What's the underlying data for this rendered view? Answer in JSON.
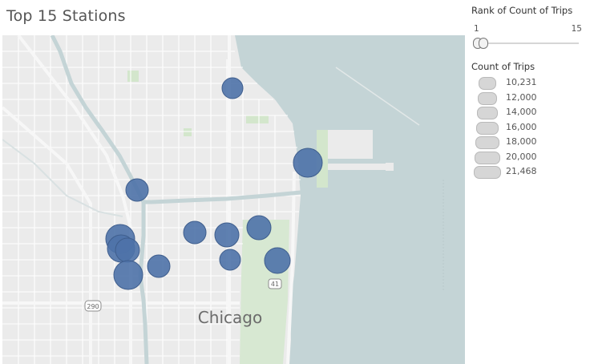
{
  "title": "Top 15 Stations",
  "rank_filter": {
    "title": "Rank of Count of Trips",
    "min_label": "1",
    "max_label": "15",
    "range": [
      1,
      15
    ]
  },
  "size_legend": {
    "title": "Count of Trips",
    "items": [
      {
        "label": "10,231",
        "value": 10231
      },
      {
        "label": "12,000",
        "value": 12000
      },
      {
        "label": "14,000",
        "value": 14000
      },
      {
        "label": "16,000",
        "value": 16000
      },
      {
        "label": "18,000",
        "value": 18000
      },
      {
        "label": "20,000",
        "value": 20000
      },
      {
        "label": "21,468",
        "value": 21468
      }
    ]
  },
  "map": {
    "city_label": "Chicago",
    "highway_shields": [
      "290",
      "41"
    ]
  },
  "colors": {
    "marker": "#4e72a8",
    "water": "#c4d4d6",
    "land": "#ebebeb",
    "park": "#d3e6cc"
  }
}
